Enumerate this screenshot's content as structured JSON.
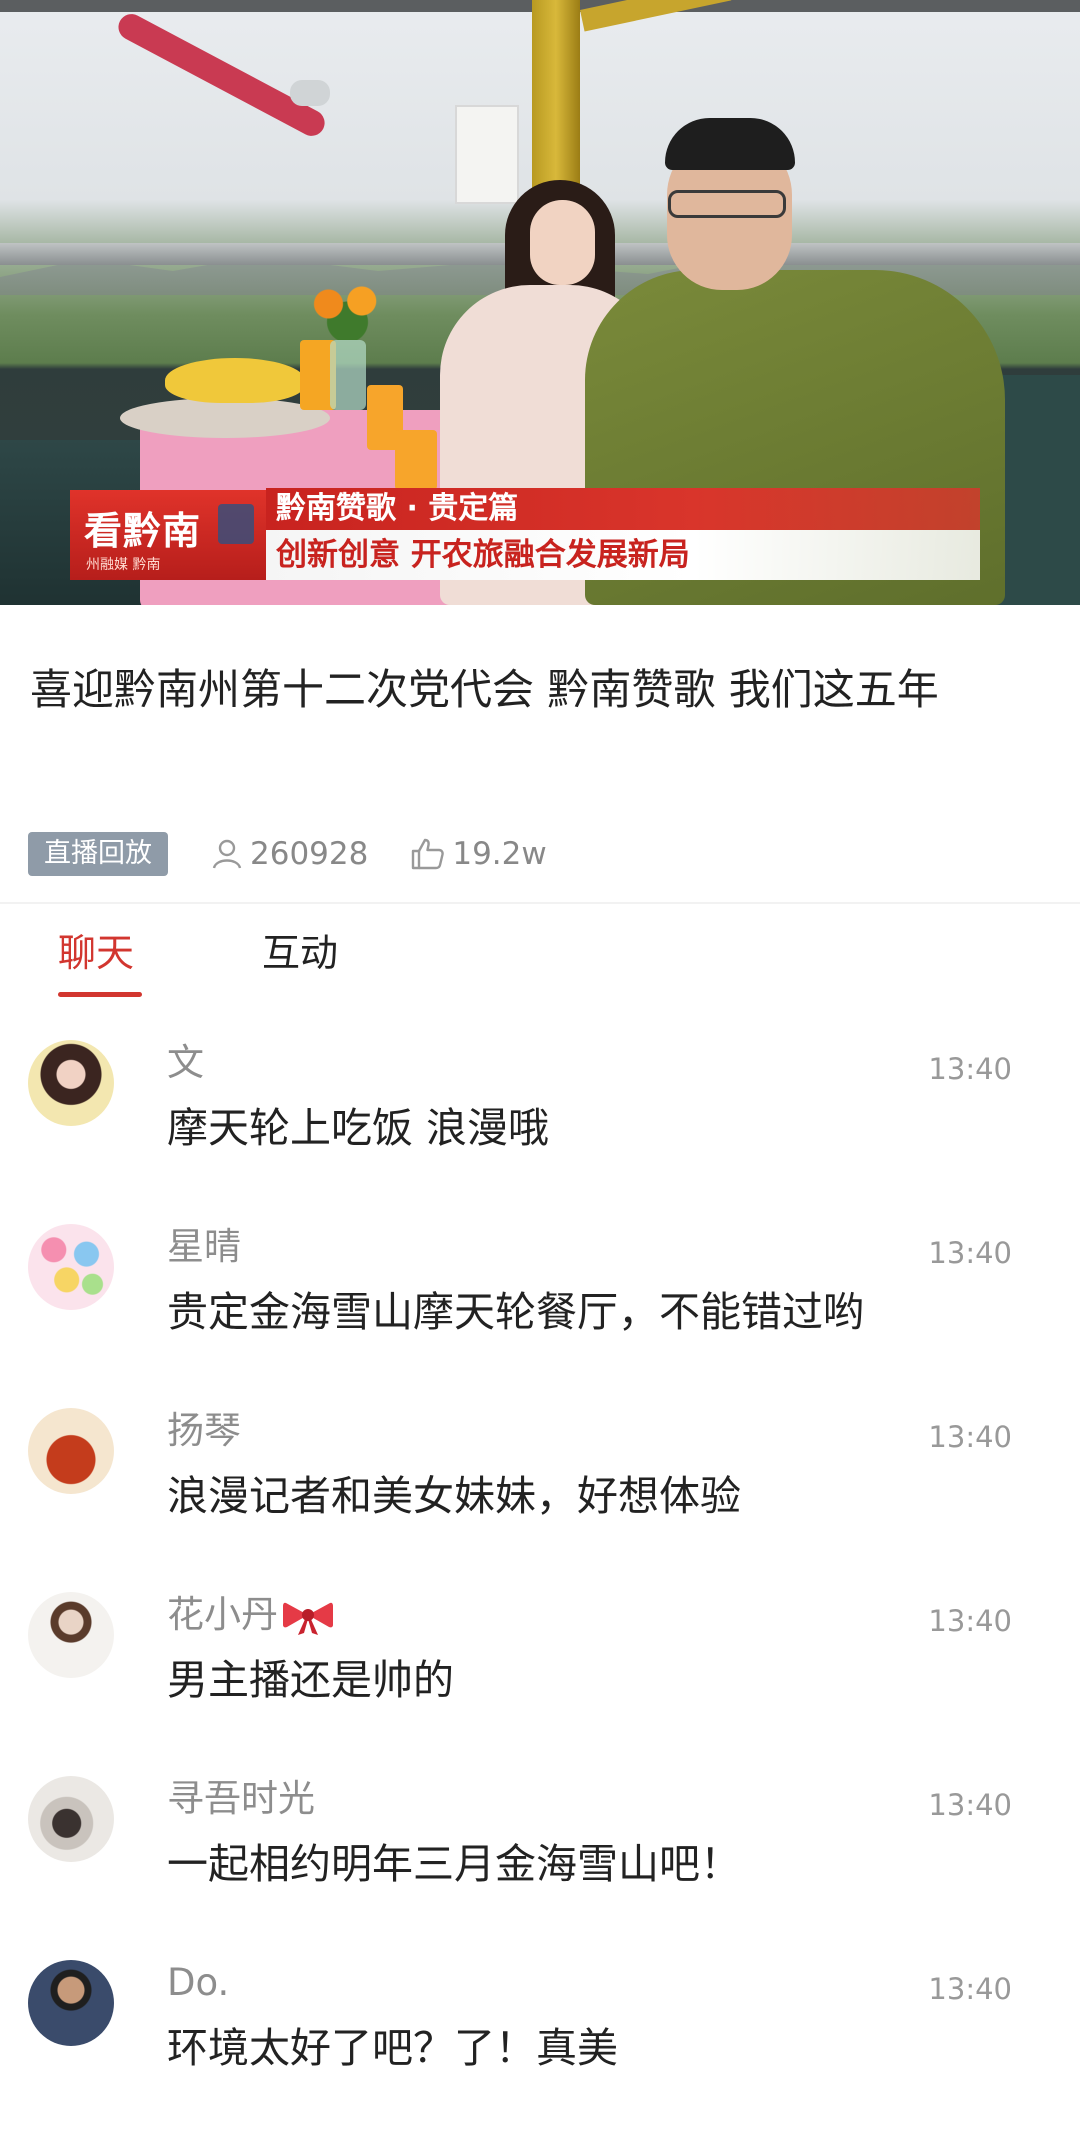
{
  "video": {
    "banner_logo": "看黔南",
    "banner_logo_sub": "州融媒 黔南",
    "banner_title": "黔南赞歌 · 贵定篇",
    "banner_subtitle": "创新创意 开农旅融合发展新局"
  },
  "title": "喜迎黔南州第十二次党代会 黔南赞歌 我们这五年",
  "meta": {
    "badge": "直播回放",
    "views": "260928",
    "likes": "19.2w"
  },
  "tabs": {
    "chat": "聊天",
    "interact": "互动"
  },
  "colors": {
    "accent": "#d2362f",
    "badge_bg": "#8f9ba8"
  },
  "comments": [
    {
      "nick": "文",
      "time": "13:40",
      "message": "摩天轮上吃饭  浪漫哦"
    },
    {
      "nick": "星晴",
      "time": "13:40",
      "message": "贵定金海雪山摩天轮餐厅，不能错过哟"
    },
    {
      "nick": "扬琴",
      "time": "13:40",
      "message": "浪漫记者和美女妹妹，好想体验"
    },
    {
      "nick": "花小丹",
      "time": "13:40",
      "message": "男主播还是帅的"
    },
    {
      "nick": "寻吾时光",
      "time": "13:40",
      "message": "一起相约明年三月金海雪山吧！"
    },
    {
      "nick": "Do.",
      "time": "13:40",
      "message": "环境太好了吧？了！真美"
    }
  ]
}
